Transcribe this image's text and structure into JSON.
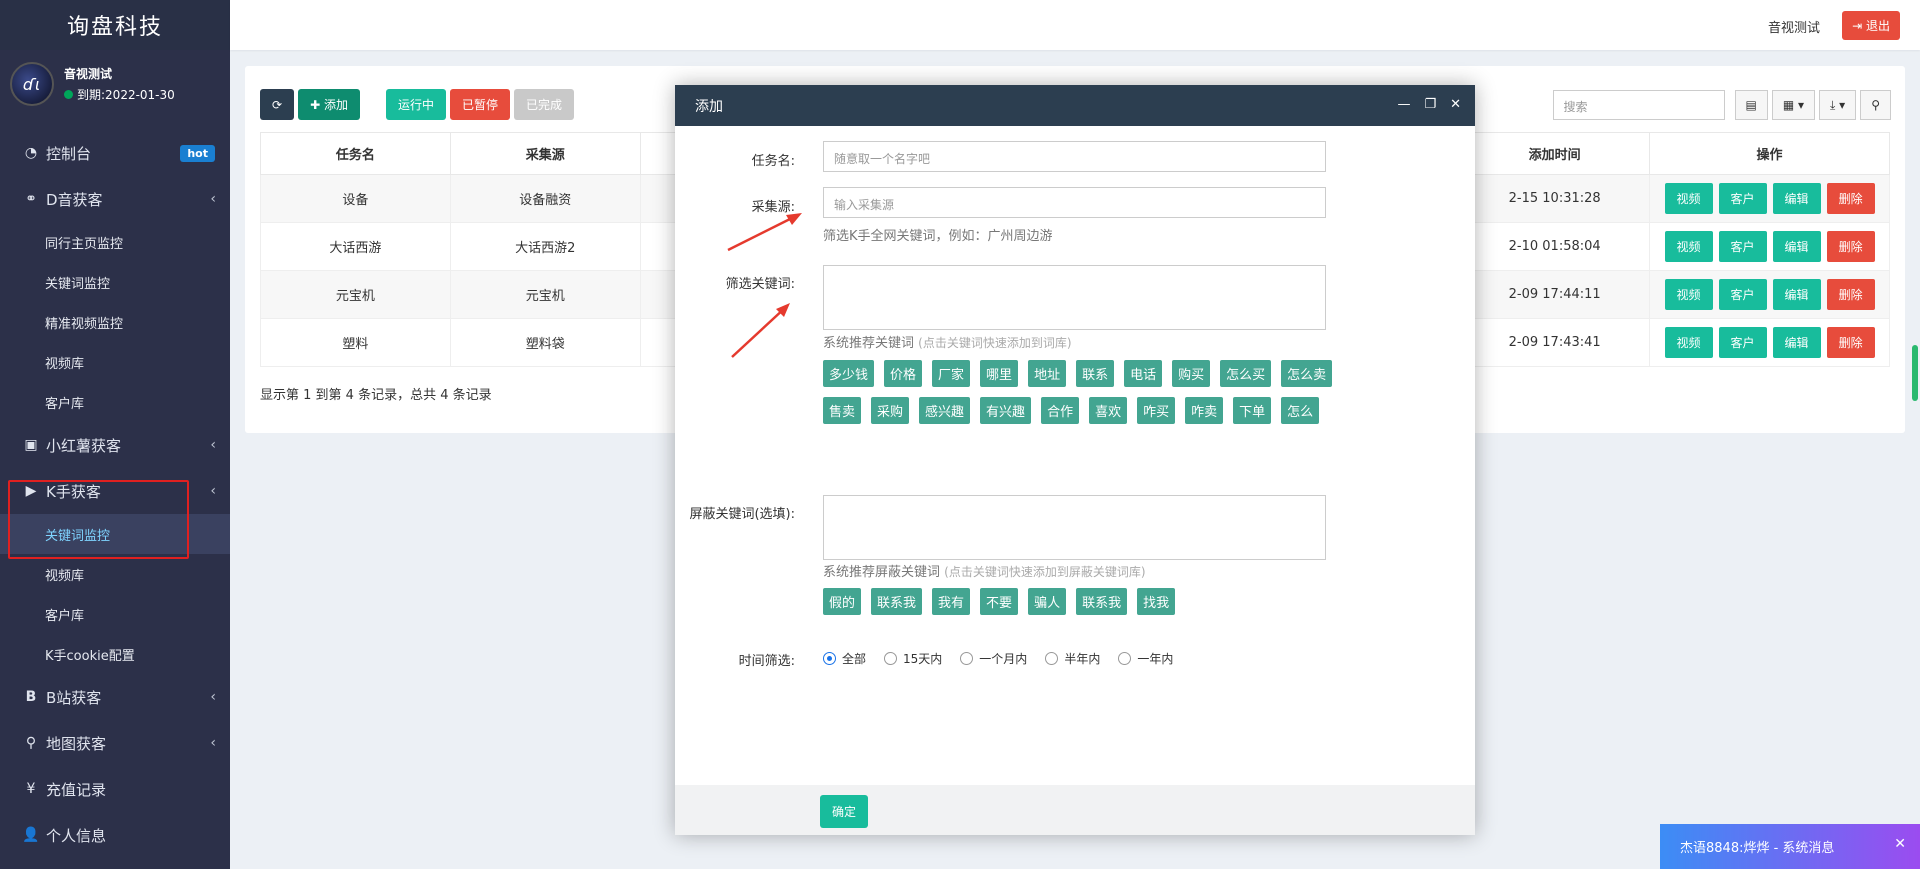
{
  "brand": "询盘科技",
  "user": {
    "name": "音视测试",
    "expire": "到期:2022-01-30",
    "avatar_glyph": "ɗɩ"
  },
  "header": {
    "username": "音视测试",
    "logout": "退出"
  },
  "menu": {
    "dashboard": {
      "label": "控制台",
      "badge": "hot",
      "icon": "dashboard-icon"
    },
    "douyin": {
      "label": "D音获客",
      "icon": "handshake-icon"
    },
    "douyin_sub": [
      "同行主页监控",
      "关键词监控",
      "精准视频监控",
      "视频库",
      "客户库"
    ],
    "xhs": {
      "label": "小红薯获客",
      "icon": "contact-icon"
    },
    "kuaishou": {
      "label": "K手获客",
      "icon": "play-circle-icon"
    },
    "kuaishou_sub": [
      "关键词监控",
      "视频库",
      "客户库",
      "K手cookie配置"
    ],
    "bilibili": {
      "label": "B站获客",
      "icon": "b-icon"
    },
    "map": {
      "label": "地图获客",
      "icon": "map-marker-icon"
    },
    "recharge": {
      "label": "充值记录",
      "icon": "yen-icon"
    },
    "profile": {
      "label": "个人信息",
      "icon": "user-icon"
    }
  },
  "toolbar": {
    "add": "添加",
    "running": "运行中",
    "paused": "已暂停",
    "done": "已完成",
    "search_placeholder": "搜索"
  },
  "table": {
    "headers": [
      "任务名",
      "采集源",
      "添加时间",
      "操作"
    ],
    "rows": [
      {
        "name": "设备",
        "source": "设备融资",
        "time": "2-15 10:31:28"
      },
      {
        "name": "大话西游",
        "source": "大话西游2",
        "time": "2-10 01:58:04"
      },
      {
        "name": "元宝机",
        "source": "元宝机",
        "time": "2-09 17:44:11"
      },
      {
        "name": "塑料",
        "source": "塑料袋",
        "time": "2-09 17:43:41"
      }
    ],
    "actions": {
      "video": "视频",
      "customer": "客户",
      "edit": "编辑",
      "delete": "删除"
    },
    "summary": "显示第 1 到第 4 条记录，总共 4 条记录"
  },
  "modal": {
    "title": "添加",
    "task_label": "任务名:",
    "task_placeholder": "随意取一个名字吧",
    "source_label": "采集源:",
    "source_placeholder": "输入采集源",
    "source_hint": "筛选K手全网关键词，例如：广州周边游",
    "filter_label": "筛选关键词:",
    "rec_label": "系统推荐关键词",
    "rec_sub": "(点击关键词快速添加到词库)",
    "keywords": [
      "多少钱",
      "价格",
      "厂家",
      "哪里",
      "地址",
      "联系",
      "电话",
      "购买",
      "怎么买",
      "怎么卖",
      "售卖",
      "采购",
      "感兴趣",
      "有兴趣",
      "合作",
      "喜欢",
      "咋买",
      "咋卖",
      "下单",
      "怎么"
    ],
    "block_label": "屏蔽关键词(选填):",
    "block_rec_label": "系统推荐屏蔽关键词",
    "block_rec_sub": "(点击关键词快速添加到屏蔽关键词库)",
    "block_keywords": [
      "假的",
      "联系我",
      "我有",
      "不要",
      "骗人",
      "联系我",
      "找我"
    ],
    "time_label": "时间筛选:",
    "time_options": [
      "全部",
      "15天内",
      "一个月内",
      "半年内",
      "一年内"
    ],
    "time_selected": "全部",
    "confirm": "确定"
  },
  "notification": {
    "text": "杰语8848:烨烨 - 系统消息"
  }
}
